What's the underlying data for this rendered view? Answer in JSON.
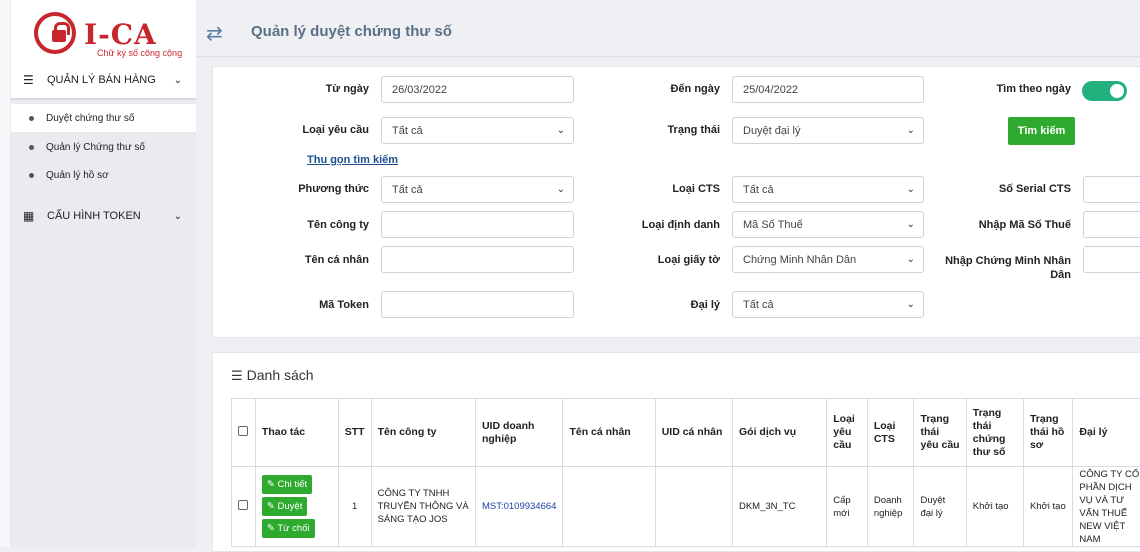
{
  "brand": {
    "logo_text": "I-CA",
    "logo_sub": "Chữ ký số công cộng"
  },
  "sidebar": {
    "group1": {
      "label": "QUẢN LÝ BÁN HÀNG"
    },
    "items": [
      {
        "label": "Duyệt chứng thư số"
      },
      {
        "label": "Quản lý Chứng thư số"
      },
      {
        "label": "Quản lý hồ sơ"
      }
    ],
    "group2": {
      "label": "CẤU HÌNH TOKEN"
    }
  },
  "header": {
    "title": "Quản lý duyệt chứng thư số"
  },
  "filters": {
    "from_date": {
      "label": "Từ ngày",
      "value": "26/03/2022"
    },
    "to_date": {
      "label": "Đến ngày",
      "value": "25/04/2022"
    },
    "by_date": {
      "label": "Tìm theo ngày",
      "on": true
    },
    "request_type": {
      "label": "Loại yêu cầu",
      "value": "Tất cả"
    },
    "status": {
      "label": "Trạng thái",
      "value": "Duyệt đại lý"
    },
    "search_button": "Tìm kiếm",
    "collapse_link": "Thu gọn tìm kiếm",
    "method": {
      "label": "Phương thức",
      "value": "Tất cả"
    },
    "cts_type": {
      "label": "Loại CTS",
      "value": "Tất cả"
    },
    "serial": {
      "label": "Số Serial CTS",
      "value": ""
    },
    "company_name": {
      "label": "Tên công ty",
      "value": ""
    },
    "id_type": {
      "label": "Loại định danh",
      "value": "Mã Số Thuế"
    },
    "tax_code": {
      "label": "Nhập Mã Số Thuế",
      "value": ""
    },
    "person_name": {
      "label": "Tên cá nhân",
      "value": ""
    },
    "doc_type": {
      "label": "Loại giấy tờ",
      "value": "Chứng Minh Nhân Dân"
    },
    "id_number": {
      "label_line1": "Nhập Chứng Minh Nhân",
      "label_line2": "Dân",
      "value": ""
    },
    "token_code": {
      "label": "Mã Token",
      "value": ""
    },
    "agent": {
      "label": "Đại lý",
      "value": "Tất cả"
    }
  },
  "list": {
    "title": "Danh sách",
    "columns": [
      "Thao tác",
      "STT",
      "Tên công ty",
      "UID doanh nghiệp",
      "Tên cá nhân",
      "UID cá nhân",
      "Gói dịch vụ",
      "Loại yêu cầu",
      "Loại CTS",
      "Trạng thái yêu cầu",
      "Trạng thái chứng thư số",
      "Trạng thái hồ sơ",
      "Đại lý"
    ],
    "actions": {
      "detail": "Chi tiết",
      "approve": "Duyệt",
      "reject": "Từ chối"
    },
    "rows": [
      {
        "stt": "1",
        "company": "CÔNG TY TNHH TRUYỀN THÔNG VÀ SÁNG TẠO JOS",
        "uid_company": "MST:0109934664",
        "person": "",
        "uid_person": "",
        "package": "DKM_3N_TC",
        "request_type": "Cấp mới",
        "cts_type": "Doanh nghiệp",
        "request_status": "Duyệt đại lý",
        "cert_status": "Khởi tạo",
        "file_status": "Khởi tạo",
        "agent": "CÔNG TY CỔ PHẦN DỊCH VỤ VÀ TƯ VẤN THUẾ NEW VIỆT NAM"
      }
    ]
  }
}
